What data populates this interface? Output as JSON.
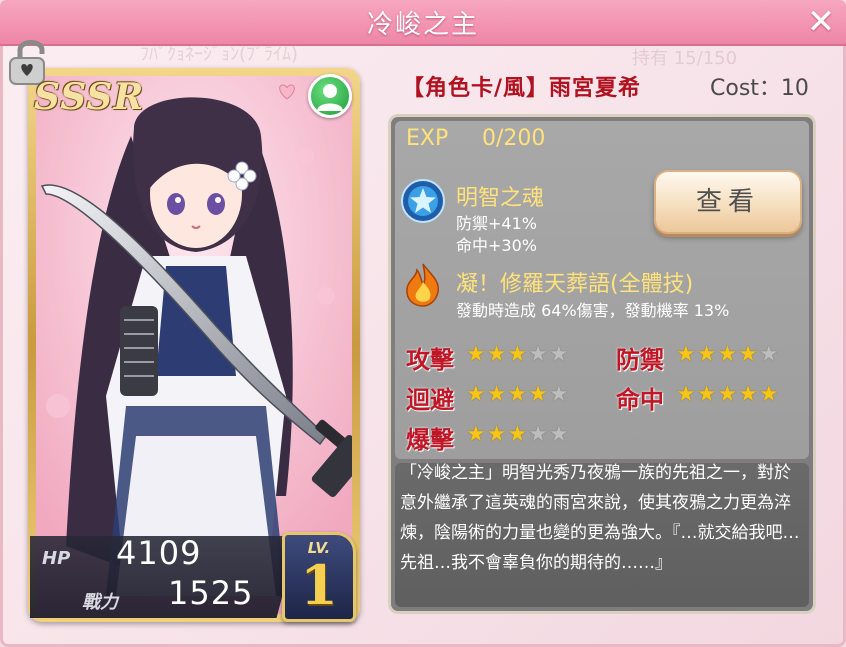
{
  "window": {
    "title": "冷峻之主",
    "close_icon": "close-icon"
  },
  "card": {
    "rarity": "SSSR",
    "hp_label": "HP",
    "hp_value": "4109",
    "power_label": "戰力",
    "power_value": "1525",
    "level_label": "LV.",
    "level_value": "1",
    "frame_color": "#d4a84a"
  },
  "header": {
    "character": "【角色卡/風】雨宮夏希",
    "cost": "Cost：10"
  },
  "exp": {
    "label": "EXP",
    "value": "0/200"
  },
  "skill_passive": {
    "icon": "star-medal-icon",
    "name": "明智之魂",
    "effects": [
      "防禦+41%",
      "命中+30%"
    ]
  },
  "view_button": {
    "label": "查看"
  },
  "skill_active": {
    "icon": "flame-icon",
    "name": "凝！修羅天葬語(全體技)",
    "description": "發動時造成 64%傷害，發動機率 13%"
  },
  "attributes": [
    {
      "label": "攻擊",
      "stars": 3,
      "max": 5
    },
    {
      "label": "防禦",
      "stars": 4,
      "max": 5
    },
    {
      "label": "迴避",
      "stars": 4,
      "max": 5
    },
    {
      "label": "命中",
      "stars": 5,
      "max": 5
    },
    {
      "label": "爆擊",
      "stars": 3,
      "max": 5
    }
  ],
  "description": "「冷峻之主」明智光秀乃夜鴉一族的先祖之一，對於意外繼承了這英魂的雨宮來說，使其夜鴉之力更為淬煉，陰陽術的力量也變的更為強大。『…就交給我吧…先祖…我不會辜負你的期待的……』",
  "colors": {
    "title_bar": "#f29ab6",
    "name_red": "#b0121f",
    "highlight_yellow": "#ffe27a",
    "star_gold": "#f7c515"
  }
}
